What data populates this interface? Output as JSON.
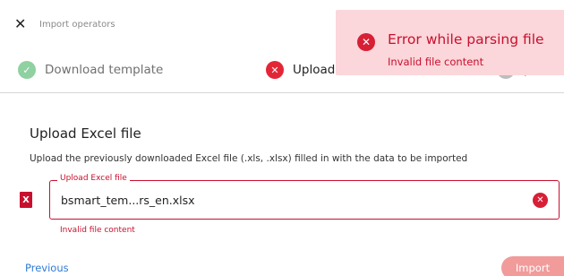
{
  "dialog": {
    "close_symbol": "✕",
    "title": "Import operators"
  },
  "steps": [
    {
      "label": "Download template",
      "status": "completed",
      "icon": "check-icon",
      "symbol": "✓"
    },
    {
      "label": "Upload f",
      "status": "error",
      "icon": "error-icon",
      "symbol": "✕"
    },
    {
      "label": "p",
      "status": "pending",
      "icon": "step-circle-icon",
      "symbol": ""
    }
  ],
  "toast": {
    "title": "Error while parsing file",
    "message": "Invalid file content",
    "icon": "error-icon",
    "symbol": "✕"
  },
  "section": {
    "title": "Upload Excel file",
    "description": "Upload the previously downloaded Excel file (.xls, .xlsx) filled in with the data to be imported"
  },
  "upload_field": {
    "label": "Upload Excel file",
    "value": "bsmart_tem...rs_en.xlsx",
    "error": "Invalid file content",
    "file_icon": "excel-file-icon",
    "file_icon_letter": "X",
    "clear_icon": "clear-icon",
    "clear_symbol": "✕"
  },
  "footer": {
    "previous_label": "Previous",
    "import_label": "Import"
  },
  "colors": {
    "error": "#c8102e",
    "success": "#8fd1a1",
    "link": "#2f7bd6",
    "toast_bg": "#fbd6da",
    "button_disabled": "#f19b9b"
  }
}
